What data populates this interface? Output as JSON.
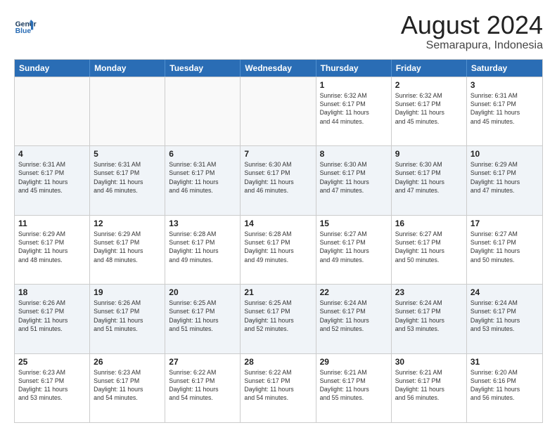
{
  "header": {
    "logo_line1": "General",
    "logo_line2": "Blue",
    "title": "August 2024",
    "subtitle": "Semarapura, Indonesia"
  },
  "days_of_week": [
    "Sunday",
    "Monday",
    "Tuesday",
    "Wednesday",
    "Thursday",
    "Friday",
    "Saturday"
  ],
  "weeks": [
    [
      {
        "day": "",
        "info": ""
      },
      {
        "day": "",
        "info": ""
      },
      {
        "day": "",
        "info": ""
      },
      {
        "day": "",
        "info": ""
      },
      {
        "day": "1",
        "info": "Sunrise: 6:32 AM\nSunset: 6:17 PM\nDaylight: 11 hours\nand 44 minutes."
      },
      {
        "day": "2",
        "info": "Sunrise: 6:32 AM\nSunset: 6:17 PM\nDaylight: 11 hours\nand 45 minutes."
      },
      {
        "day": "3",
        "info": "Sunrise: 6:31 AM\nSunset: 6:17 PM\nDaylight: 11 hours\nand 45 minutes."
      }
    ],
    [
      {
        "day": "4",
        "info": "Sunrise: 6:31 AM\nSunset: 6:17 PM\nDaylight: 11 hours\nand 45 minutes."
      },
      {
        "day": "5",
        "info": "Sunrise: 6:31 AM\nSunset: 6:17 PM\nDaylight: 11 hours\nand 46 minutes."
      },
      {
        "day": "6",
        "info": "Sunrise: 6:31 AM\nSunset: 6:17 PM\nDaylight: 11 hours\nand 46 minutes."
      },
      {
        "day": "7",
        "info": "Sunrise: 6:30 AM\nSunset: 6:17 PM\nDaylight: 11 hours\nand 46 minutes."
      },
      {
        "day": "8",
        "info": "Sunrise: 6:30 AM\nSunset: 6:17 PM\nDaylight: 11 hours\nand 47 minutes."
      },
      {
        "day": "9",
        "info": "Sunrise: 6:30 AM\nSunset: 6:17 PM\nDaylight: 11 hours\nand 47 minutes."
      },
      {
        "day": "10",
        "info": "Sunrise: 6:29 AM\nSunset: 6:17 PM\nDaylight: 11 hours\nand 47 minutes."
      }
    ],
    [
      {
        "day": "11",
        "info": "Sunrise: 6:29 AM\nSunset: 6:17 PM\nDaylight: 11 hours\nand 48 minutes."
      },
      {
        "day": "12",
        "info": "Sunrise: 6:29 AM\nSunset: 6:17 PM\nDaylight: 11 hours\nand 48 minutes."
      },
      {
        "day": "13",
        "info": "Sunrise: 6:28 AM\nSunset: 6:17 PM\nDaylight: 11 hours\nand 49 minutes."
      },
      {
        "day": "14",
        "info": "Sunrise: 6:28 AM\nSunset: 6:17 PM\nDaylight: 11 hours\nand 49 minutes."
      },
      {
        "day": "15",
        "info": "Sunrise: 6:27 AM\nSunset: 6:17 PM\nDaylight: 11 hours\nand 49 minutes."
      },
      {
        "day": "16",
        "info": "Sunrise: 6:27 AM\nSunset: 6:17 PM\nDaylight: 11 hours\nand 50 minutes."
      },
      {
        "day": "17",
        "info": "Sunrise: 6:27 AM\nSunset: 6:17 PM\nDaylight: 11 hours\nand 50 minutes."
      }
    ],
    [
      {
        "day": "18",
        "info": "Sunrise: 6:26 AM\nSunset: 6:17 PM\nDaylight: 11 hours\nand 51 minutes."
      },
      {
        "day": "19",
        "info": "Sunrise: 6:26 AM\nSunset: 6:17 PM\nDaylight: 11 hours\nand 51 minutes."
      },
      {
        "day": "20",
        "info": "Sunrise: 6:25 AM\nSunset: 6:17 PM\nDaylight: 11 hours\nand 51 minutes."
      },
      {
        "day": "21",
        "info": "Sunrise: 6:25 AM\nSunset: 6:17 PM\nDaylight: 11 hours\nand 52 minutes."
      },
      {
        "day": "22",
        "info": "Sunrise: 6:24 AM\nSunset: 6:17 PM\nDaylight: 11 hours\nand 52 minutes."
      },
      {
        "day": "23",
        "info": "Sunrise: 6:24 AM\nSunset: 6:17 PM\nDaylight: 11 hours\nand 53 minutes."
      },
      {
        "day": "24",
        "info": "Sunrise: 6:24 AM\nSunset: 6:17 PM\nDaylight: 11 hours\nand 53 minutes."
      }
    ],
    [
      {
        "day": "25",
        "info": "Sunrise: 6:23 AM\nSunset: 6:17 PM\nDaylight: 11 hours\nand 53 minutes."
      },
      {
        "day": "26",
        "info": "Sunrise: 6:23 AM\nSunset: 6:17 PM\nDaylight: 11 hours\nand 54 minutes."
      },
      {
        "day": "27",
        "info": "Sunrise: 6:22 AM\nSunset: 6:17 PM\nDaylight: 11 hours\nand 54 minutes."
      },
      {
        "day": "28",
        "info": "Sunrise: 6:22 AM\nSunset: 6:17 PM\nDaylight: 11 hours\nand 54 minutes."
      },
      {
        "day": "29",
        "info": "Sunrise: 6:21 AM\nSunset: 6:17 PM\nDaylight: 11 hours\nand 55 minutes."
      },
      {
        "day": "30",
        "info": "Sunrise: 6:21 AM\nSunset: 6:17 PM\nDaylight: 11 hours\nand 56 minutes."
      },
      {
        "day": "31",
        "info": "Sunrise: 6:20 AM\nSunset: 6:16 PM\nDaylight: 11 hours\nand 56 minutes."
      }
    ]
  ]
}
